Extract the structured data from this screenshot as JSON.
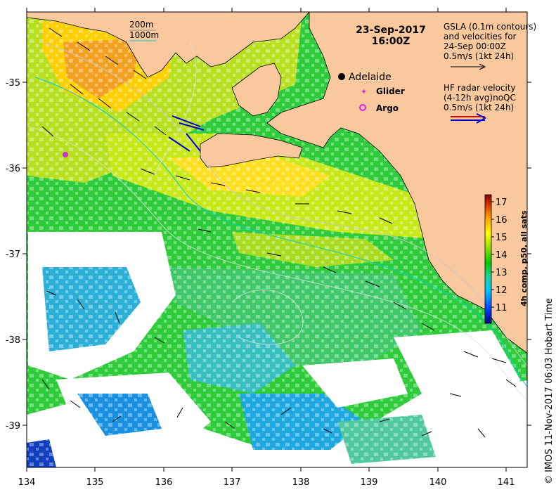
{
  "title": {
    "date": "23-Sep-2017",
    "time": "16:00Z"
  },
  "map": {
    "lon_range": [
      134,
      141.3
    ],
    "lat_range": [
      -39.5,
      -34.2
    ],
    "x_ticks": [
      "134",
      "135",
      "136",
      "137",
      "138",
      "139",
      "140",
      "141"
    ],
    "y_ticks": [
      "-35",
      "-36",
      "-37",
      "-38",
      "-39"
    ],
    "land_color": "#f9c89c",
    "ocean_nodata_color": "#ffffff"
  },
  "depth_legend": {
    "items": [
      {
        "label": "200m",
        "color": "#999999"
      },
      {
        "label": "1000m",
        "color": "#00cccc"
      }
    ]
  },
  "markers": {
    "city": {
      "label": "Adelaide",
      "lon": 138.6,
      "lat": -34.93
    },
    "glider": {
      "label": "Glider",
      "color": "#cc33cc"
    },
    "argo": {
      "label": "Argo",
      "color": "#e020e0"
    },
    "glider_position": {
      "lon": 134.56,
      "lat": -35.83
    }
  },
  "gsla_legend": {
    "lines": [
      "GSLA (0.1m contours)",
      "and velocities for",
      "24-Sep 00:00Z",
      "0.5m/s (1kt 24h)"
    ]
  },
  "radar_legend": {
    "lines": [
      "HF radar velocity",
      "(4-12h avg)noQC",
      "0.5m/s (1kt 24h)"
    ]
  },
  "colorbar": {
    "title": "4h comp, p50, all sats",
    "range": [
      10.3,
      17.6
    ],
    "ticks": [
      "11",
      "12",
      "13",
      "14",
      "15",
      "16",
      "17"
    ],
    "colormap": [
      "#00007f",
      "#0040ff",
      "#00c0ff",
      "#20d0a0",
      "#00c800",
      "#a0e000",
      "#ffff00",
      "#ffa000",
      "#d03000",
      "#800000"
    ]
  },
  "credit": "© IMOS 11-Nov-2017 06:03 Hobart Time"
}
